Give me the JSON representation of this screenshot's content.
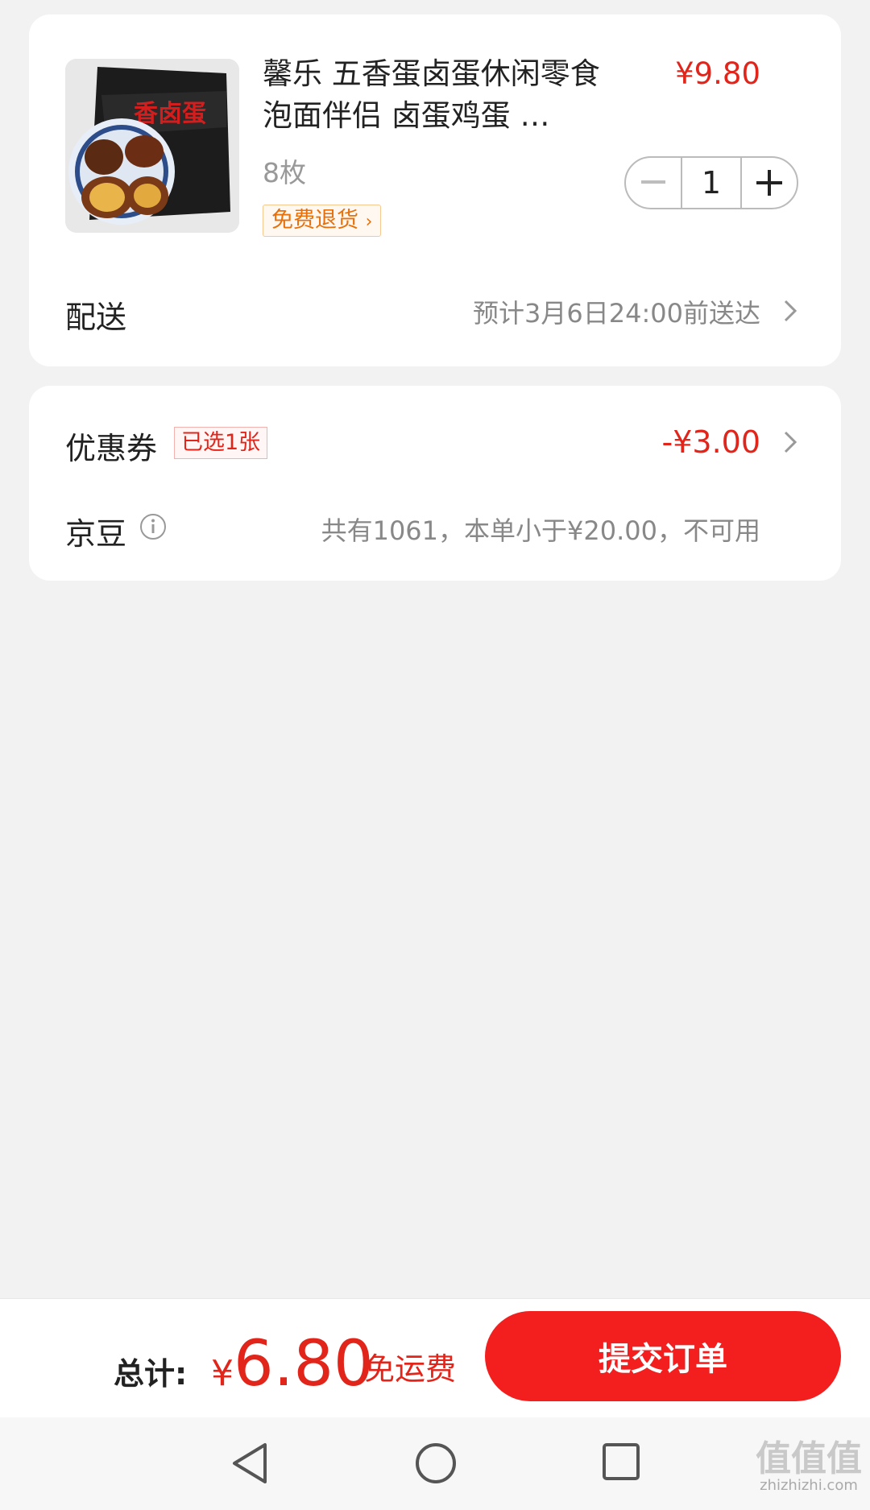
{
  "product": {
    "title": "馨乐 五香蛋卤蛋休闲零食泡面伴侣 卤蛋鸡蛋 …",
    "price": "¥9.80",
    "spec": "8枚",
    "return_tag": "免费退货",
    "quantity": "1",
    "image_lettering": "香卤蛋"
  },
  "delivery": {
    "label": "配送",
    "estimate": "预计3月6日24:00前送达"
  },
  "coupon": {
    "label": "优惠券",
    "badge": "已选1张",
    "amount": "-¥3.00"
  },
  "jingdou": {
    "label": "京豆",
    "note": "共有1061，本单小于¥20.00，不可用"
  },
  "footer": {
    "total_label": "总计:",
    "currency": "¥",
    "total_amount": "6.80",
    "shipping": "免运费",
    "submit_label": "提交订单"
  },
  "watermark": {
    "text": "值值值",
    "domain": "zhizhizhi.com"
  },
  "colors": {
    "accent": "#e1251b",
    "button": "#f31f1f",
    "background": "#f2f2f2"
  }
}
